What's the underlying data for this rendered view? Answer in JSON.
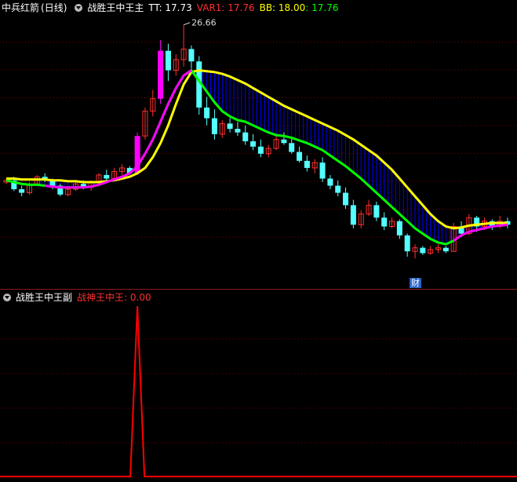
{
  "main_panel": {
    "stock_title": "中兵红箭",
    "period": "(日线)",
    "indicator_name": "战胜王中王主",
    "tt_label": "TT: 17.73",
    "var1_label": "VAR1: 17.76",
    "bb_label": "BB: 18.00",
    "extra_value": ": 17.76",
    "high_marker": "26.66",
    "event_badge": "财"
  },
  "sub_panel": {
    "indicator_name": "战胜王中王副",
    "value_label": "战神王中王: 0.00"
  },
  "colors": {
    "background": "#000000",
    "up_candle": "#ff3030",
    "down_candle": "#54ffff",
    "yellow_line": "#ffff00",
    "green_line": "#00ff00",
    "magenta_line": "#ff00ff",
    "fill_lines": "#0000ff",
    "sub_line": "#ff0000",
    "grid": "#7a0000"
  },
  "chart_data": {
    "type": "candlestick",
    "candles_ohlc": [
      [
        17.8,
        18.0,
        17.7,
        17.9
      ],
      [
        17.9,
        18.1,
        17.3,
        17.4
      ],
      [
        17.4,
        17.6,
        17.0,
        17.2
      ],
      [
        17.2,
        17.8,
        17.1,
        17.7
      ],
      [
        17.7,
        18.2,
        17.6,
        18.1
      ],
      [
        18.1,
        18.3,
        17.8,
        17.9
      ],
      [
        17.9,
        18.0,
        17.4,
        17.6
      ],
      [
        17.6,
        17.7,
        17.0,
        17.1
      ],
      [
        17.1,
        17.5,
        17.0,
        17.4
      ],
      [
        17.4,
        17.8,
        17.3,
        17.7
      ],
      [
        17.7,
        17.9,
        17.4,
        17.5
      ],
      [
        17.5,
        17.9,
        17.3,
        17.8
      ],
      [
        17.8,
        18.3,
        17.7,
        18.2
      ],
      [
        18.2,
        18.5,
        17.9,
        18.0
      ],
      [
        18.0,
        18.6,
        17.9,
        18.4
      ],
      [
        18.4,
        18.8,
        18.2,
        18.6
      ],
      [
        18.6,
        18.7,
        18.2,
        18.3
      ],
      [
        18.3,
        20.6,
        18.2,
        20.4
      ],
      [
        20.4,
        22.0,
        20.2,
        21.8
      ],
      [
        21.8,
        23.0,
        21.5,
        22.5
      ],
      [
        22.5,
        25.8,
        22.2,
        25.2
      ],
      [
        25.2,
        25.6,
        23.5,
        24.1
      ],
      [
        24.1,
        25.0,
        23.8,
        24.7
      ],
      [
        24.7,
        26.66,
        24.3,
        25.3
      ],
      [
        25.3,
        25.5,
        24.2,
        24.6
      ],
      [
        24.6,
        24.9,
        21.6,
        22.0
      ],
      [
        22.0,
        22.6,
        21.0,
        21.4
      ],
      [
        21.4,
        21.9,
        20.2,
        20.5
      ],
      [
        20.5,
        21.3,
        20.3,
        21.1
      ],
      [
        21.1,
        21.4,
        20.6,
        20.8
      ],
      [
        20.8,
        21.2,
        20.4,
        20.6
      ],
      [
        20.6,
        21.0,
        19.9,
        20.1
      ],
      [
        20.1,
        20.5,
        19.6,
        19.8
      ],
      [
        19.8,
        20.2,
        19.2,
        19.4
      ],
      [
        19.4,
        19.9,
        19.2,
        19.7
      ],
      [
        19.7,
        20.4,
        19.6,
        20.2
      ],
      [
        20.2,
        20.6,
        19.9,
        20.0
      ],
      [
        20.0,
        20.3,
        19.4,
        19.5
      ],
      [
        19.5,
        19.8,
        18.9,
        19.0
      ],
      [
        19.0,
        19.3,
        18.4,
        18.6
      ],
      [
        18.6,
        19.1,
        18.3,
        18.9
      ],
      [
        18.9,
        19.2,
        17.8,
        18.0
      ],
      [
        18.0,
        18.2,
        17.4,
        17.6
      ],
      [
        17.6,
        17.9,
        17.0,
        17.2
      ],
      [
        17.2,
        17.5,
        16.3,
        16.5
      ],
      [
        16.5,
        16.8,
        15.2,
        15.4
      ],
      [
        15.4,
        16.2,
        15.2,
        16.0
      ],
      [
        16.0,
        16.8,
        15.9,
        16.5
      ],
      [
        16.5,
        16.7,
        15.6,
        15.8
      ],
      [
        15.8,
        16.1,
        15.1,
        15.3
      ],
      [
        15.3,
        15.8,
        15.2,
        15.6
      ],
      [
        15.6,
        15.7,
        14.6,
        14.8
      ],
      [
        14.8,
        14.9,
        13.6,
        13.9
      ],
      [
        13.9,
        14.3,
        13.5,
        14.1
      ],
      [
        14.1,
        14.2,
        13.7,
        13.8
      ],
      [
        13.8,
        14.2,
        13.7,
        14.0
      ],
      [
        14.0,
        14.3,
        13.8,
        14.1
      ],
      [
        14.1,
        14.2,
        13.8,
        13.9
      ],
      [
        13.9,
        15.5,
        13.9,
        15.3
      ],
      [
        15.3,
        15.6,
        14.7,
        14.9
      ],
      [
        14.9,
        16.0,
        14.8,
        15.8
      ],
      [
        15.8,
        15.9,
        15.0,
        15.3
      ],
      [
        15.3,
        15.8,
        15.1,
        15.6
      ],
      [
        15.6,
        15.7,
        15.1,
        15.3
      ],
      [
        15.3,
        15.9,
        15.2,
        15.6
      ],
      [
        15.6,
        15.8,
        15.2,
        15.4
      ]
    ],
    "yellow_series": [
      18.0,
      18.0,
      17.95,
      17.95,
      17.95,
      17.95,
      17.9,
      17.9,
      17.85,
      17.85,
      17.8,
      17.8,
      17.8,
      17.85,
      17.9,
      18.0,
      18.1,
      18.3,
      18.6,
      19.2,
      20.0,
      21.0,
      22.2,
      23.3,
      24.0,
      24.1,
      24.05,
      24.0,
      23.9,
      23.75,
      23.55,
      23.35,
      23.1,
      22.85,
      22.6,
      22.35,
      22.1,
      21.9,
      21.7,
      21.5,
      21.3,
      21.1,
      20.9,
      20.7,
      20.45,
      20.2,
      19.9,
      19.6,
      19.3,
      18.9,
      18.5,
      18.0,
      17.5,
      17.0,
      16.5,
      16.0,
      15.6,
      15.3,
      15.2,
      15.25,
      15.35,
      15.4,
      15.45,
      15.5,
      15.5,
      15.5
    ],
    "green_series": [
      17.9,
      17.8,
      17.7,
      17.65,
      17.65,
      17.6,
      17.55,
      17.5,
      17.5,
      17.5,
      17.5,
      17.55,
      17.65,
      17.8,
      17.95,
      18.1,
      18.3,
      18.7,
      19.4,
      20.2,
      21.2,
      22.2,
      23.1,
      23.8,
      24.1,
      23.5,
      22.9,
      22.3,
      21.8,
      21.5,
      21.3,
      21.2,
      21.0,
      20.8,
      20.6,
      20.45,
      20.4,
      20.3,
      20.15,
      20.0,
      19.8,
      19.6,
      19.3,
      19.0,
      18.7,
      18.35,
      18.0,
      17.6,
      17.2,
      16.8,
      16.4,
      16.0,
      15.6,
      15.2,
      14.9,
      14.6,
      14.4,
      14.3,
      14.5,
      14.8,
      15.0,
      15.1,
      15.2,
      15.3,
      15.35,
      15.4
    ],
    "magenta_before_index": 25,
    "subchart": {
      "baseline": 0,
      "spike_index": 17,
      "spike_value": 1,
      "values_note_shown": "0.00"
    }
  }
}
